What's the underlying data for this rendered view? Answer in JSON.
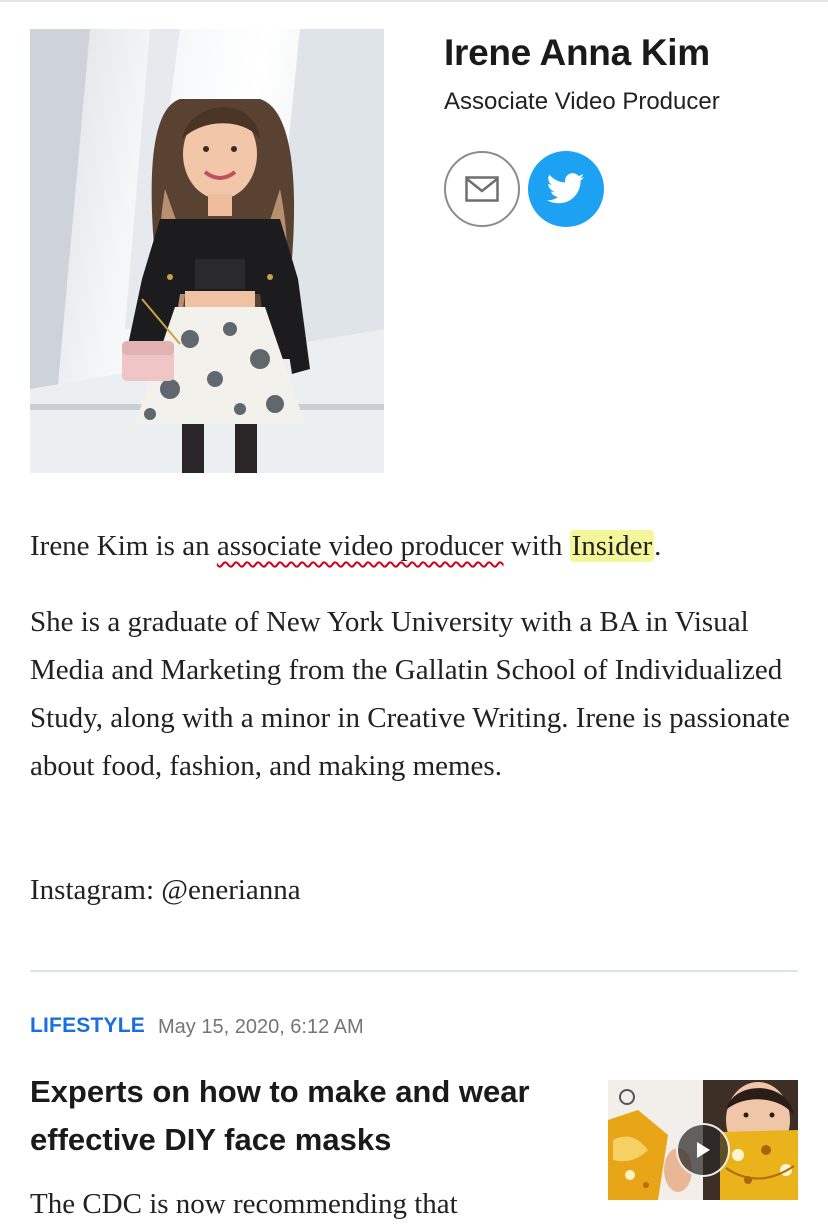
{
  "author": {
    "name": "Irene Anna Kim",
    "title": "Associate Video Producer",
    "photo_icon": "author-portrait",
    "social": {
      "email_icon": "envelope-icon",
      "twitter_icon": "twitter-bird-icon",
      "twitter_color": "#1da1f2"
    }
  },
  "bio": {
    "p1_prefix": "Irene Kim is an ",
    "p1_role": "associate video producer",
    "p1_mid": " with ",
    "p1_org": "Insider",
    "p1_suffix": ".",
    "p2": "She is a graduate of New York University with a BA in Visual Media and Marketing from the Gallatin School of Individualized Study, along with a minor in Creative Writing. Irene is passionate about food, fashion, and making memes.",
    "p3": "Instagram: @enerianna"
  },
  "article": {
    "category": "LIFESTYLE",
    "date": "May 15, 2020, 6:12 AM",
    "headline": "Experts on how to make and wear effective DIY face masks",
    "excerpt": "The CDC is now recommending that",
    "thumbnail_icon": "video-thumbnail",
    "play_icon": "play-icon",
    "category_color": "#1b6ee0"
  }
}
